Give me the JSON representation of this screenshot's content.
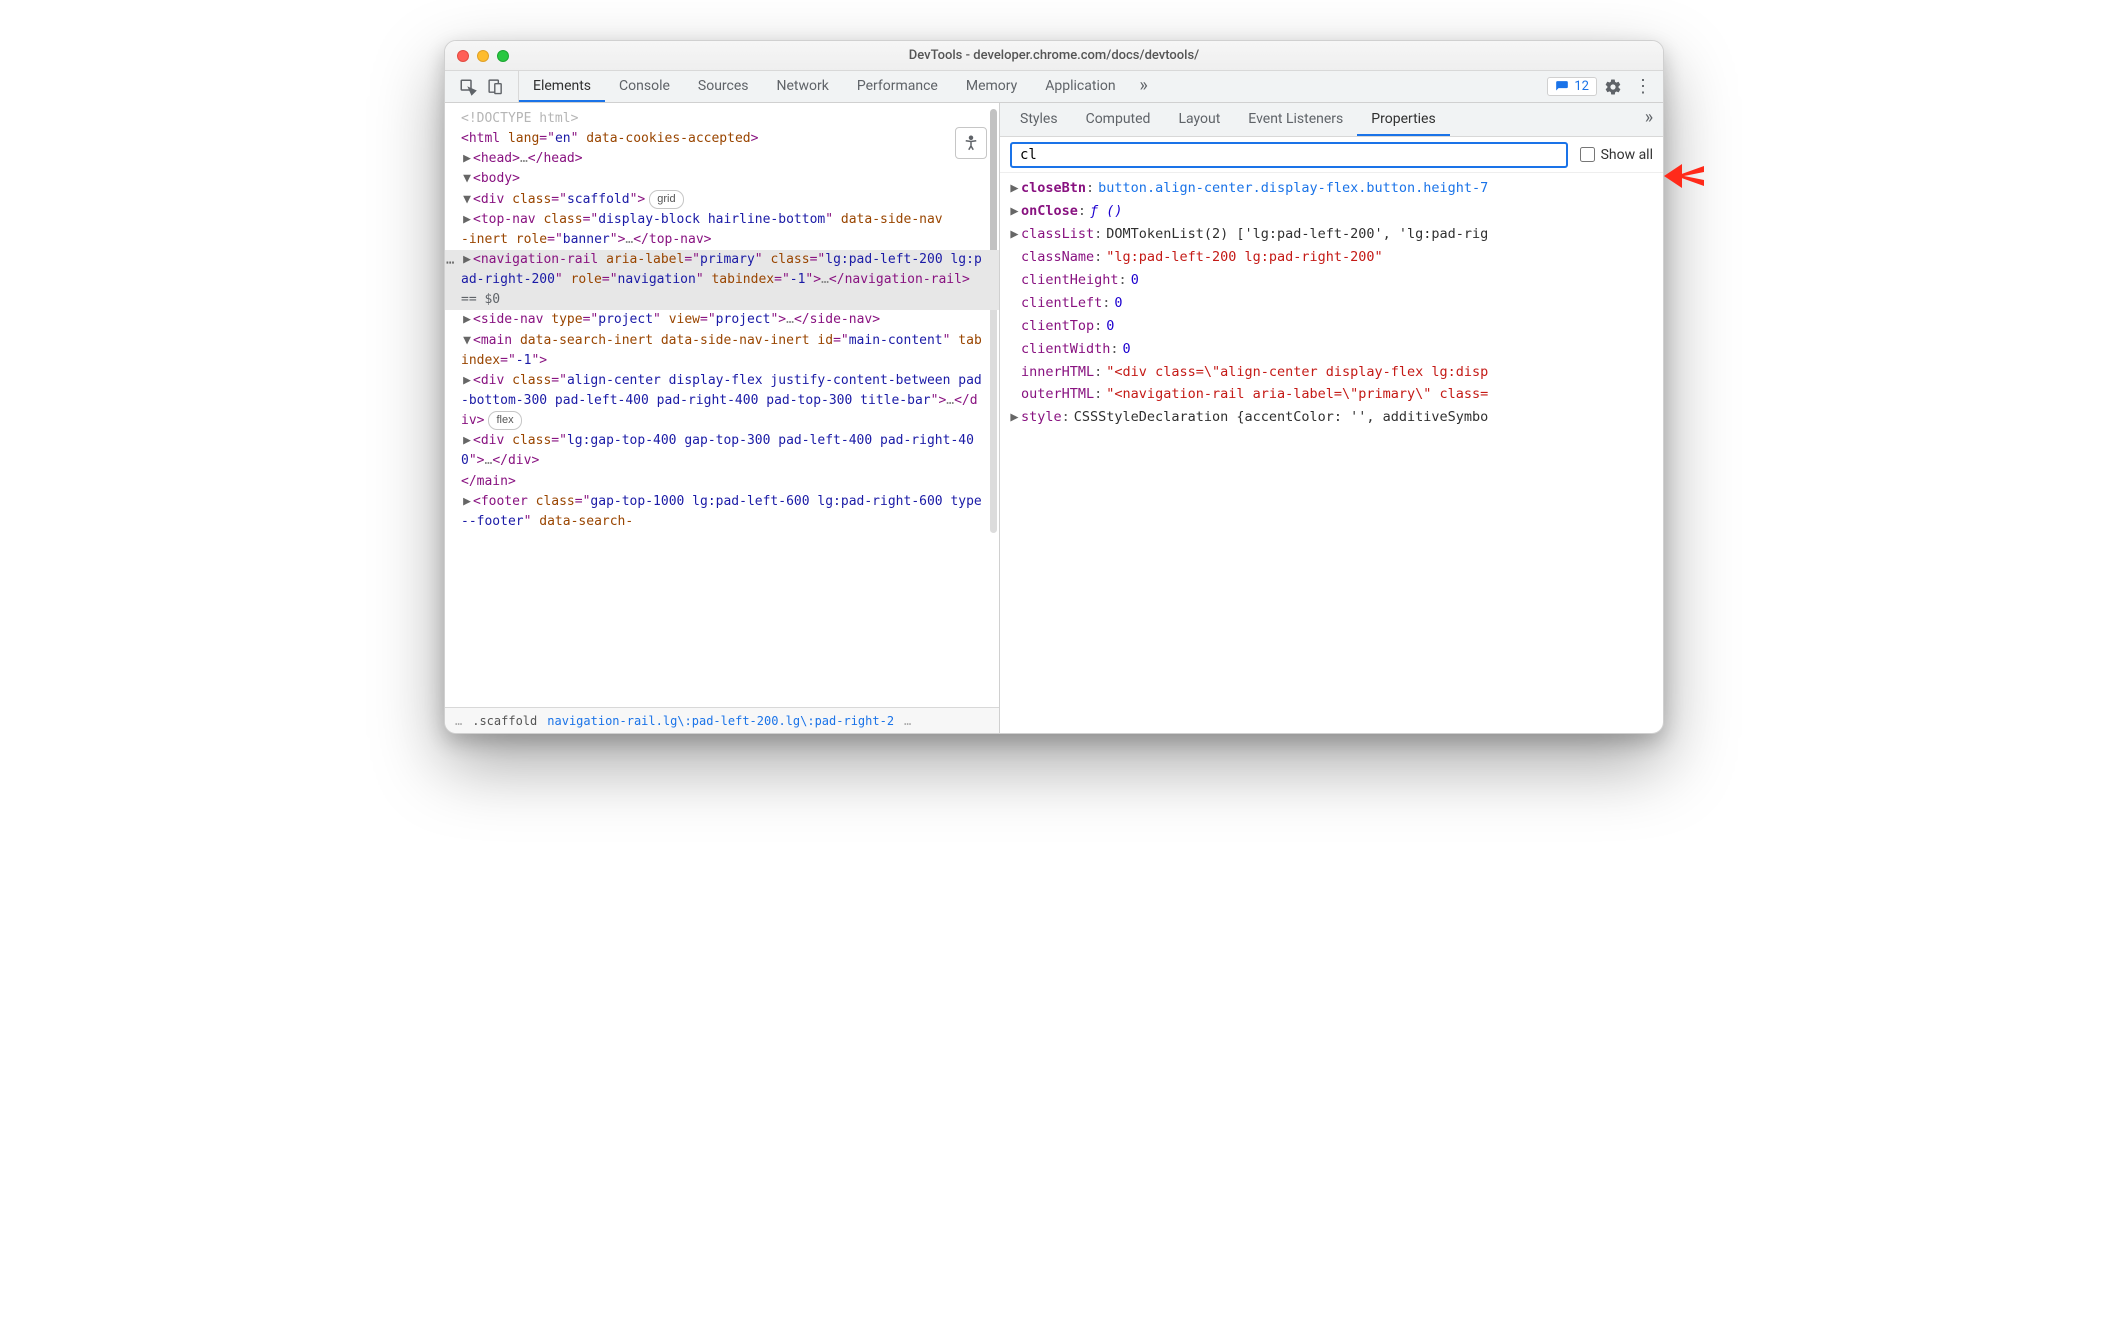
{
  "window": {
    "title": "DevTools - developer.chrome.com/docs/devtools/"
  },
  "toolbar": {
    "tabs": [
      "Elements",
      "Console",
      "Sources",
      "Network",
      "Performance",
      "Memory",
      "Application"
    ],
    "overflow": "»",
    "issues_count": "12"
  },
  "a11y": {
    "tooltip": "Accessibility"
  },
  "dom": {
    "doctype": "<!DOCTYPE html>",
    "html_open": {
      "tag": "html",
      "attrs": [
        {
          "n": "lang",
          "v": "en"
        },
        {
          "n": "data-cookies-accepted",
          "v": null
        }
      ]
    },
    "head": {
      "open": "head",
      "ell": "…",
      "close": "head"
    },
    "body": {
      "open": "body"
    },
    "scaffold": {
      "tag": "div",
      "attrs": [
        {
          "n": "class",
          "v": "scaffold"
        }
      ],
      "badge": "grid"
    },
    "topnav": {
      "tag": "top-nav",
      "attrs_text": "class=\"display-block hairline-bottom\" data-side-nav-inert role=\"banner\"",
      "ell": "…"
    },
    "navrail": {
      "tag": "navigation-rail",
      "attrs_text": "aria-label=\"primary\" class=\"lg:pad-left-200 lg:pad-right-200\" role=\"navigation\" tabindex=\"-1\"",
      "ell": "…",
      "cursor": "== $0"
    },
    "sidenav": {
      "tag": "side-nav",
      "attrs_text": "type=\"project\" view=\"project\"",
      "ell": "…"
    },
    "main": {
      "tag": "main",
      "attrs_text": "data-search-inert data-side-nav-inert id=\"main-content\" tabindex=\"-1\""
    },
    "div_title": {
      "tag": "div",
      "attrs_text": "class=\"align-center display-flex justify-content-between pad-bottom-300 pad-left-400 pad-right-400 pad-top-300 title-bar\"",
      "ell": "…",
      "badge": "flex"
    },
    "div_gap": {
      "tag": "div",
      "attrs_text": "class=\"lg:gap-top-400 gap-top-300 pad-left-400 pad-right-400\"",
      "ell": "…"
    },
    "footer": {
      "tag": "footer",
      "attrs_text": "class=\"gap-top-1000 lg:pad-left-600 lg:pad-right-600 type--footer\" data-search-"
    }
  },
  "breadcrumb": {
    "pre_ell": "…",
    "crumb1": ".scaffold",
    "crumb2": "navigation-rail.lg\\:pad-left-200.lg\\:pad-right-2",
    "post_ell": "…"
  },
  "sidebar": {
    "tabs": [
      "Styles",
      "Computed",
      "Layout",
      "Event Listeners",
      "Properties"
    ],
    "overflow": "»"
  },
  "filter": {
    "value": "cl",
    "showall_label": "Show all"
  },
  "properties": [
    {
      "tw": "▶",
      "key": "closeBtn",
      "bold": true,
      "type": "link",
      "value": "button.align-center.display-flex.button.height-7"
    },
    {
      "tw": "▶",
      "key": "onClose",
      "bold": true,
      "type": "fn",
      "value": "ƒ ()"
    },
    {
      "tw": "▶",
      "key": "classList",
      "type": "obj",
      "value": "DOMTokenList(2) ['lg:pad-left-200', 'lg:pad-rig"
    },
    {
      "tw": "",
      "key": "className",
      "type": "str",
      "value": "\"lg:pad-left-200 lg:pad-right-200\""
    },
    {
      "tw": "",
      "key": "clientHeight",
      "type": "num",
      "value": "0"
    },
    {
      "tw": "",
      "key": "clientLeft",
      "type": "num",
      "value": "0"
    },
    {
      "tw": "",
      "key": "clientTop",
      "type": "num",
      "value": "0"
    },
    {
      "tw": "",
      "key": "clientWidth",
      "type": "num",
      "value": "0"
    },
    {
      "tw": "",
      "key": "innerHTML",
      "type": "str",
      "value": "\"<div class=\\\"align-center display-flex lg:disp"
    },
    {
      "tw": "",
      "key": "outerHTML",
      "type": "str",
      "value": "\"<navigation-rail aria-label=\\\"primary\\\" class="
    },
    {
      "tw": "▶",
      "key": "style",
      "type": "obj",
      "value": "CSSStyleDeclaration {accentColor: '', additiveSymbo"
    }
  ]
}
